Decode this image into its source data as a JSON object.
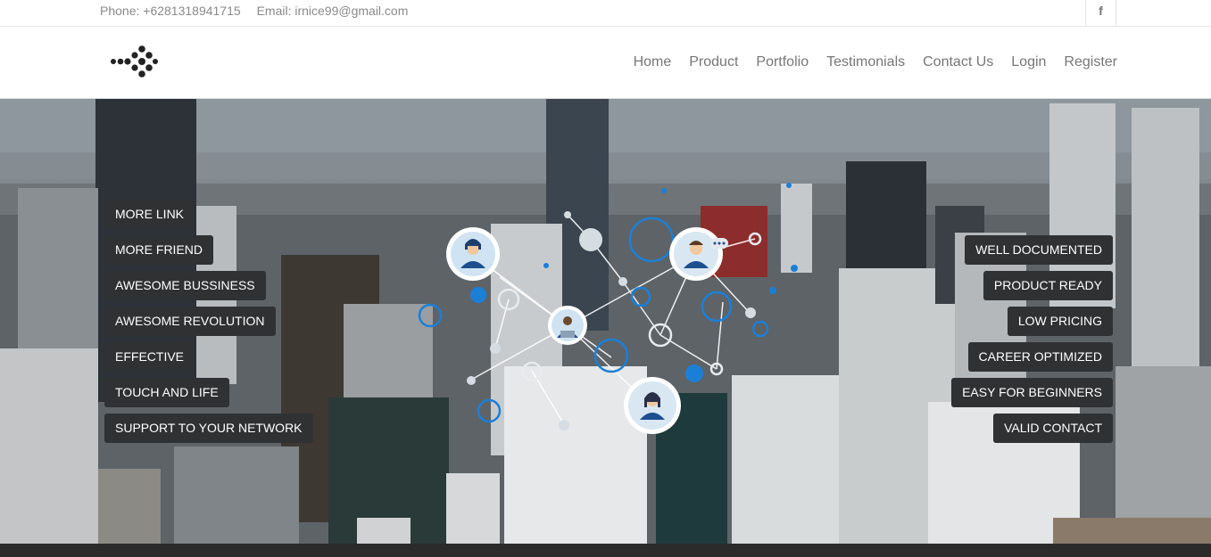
{
  "topbar": {
    "phone": "Phone: +6281318941715",
    "email": "Email: irnice99@gmail.com",
    "social_icon": "facebook-icon",
    "social_glyph": "f"
  },
  "nav": {
    "items": [
      "Home",
      "Product",
      "Portfolio",
      "Testimonials",
      "Contact Us",
      "Login",
      "Register"
    ]
  },
  "hero": {
    "left_tags": [
      "MORE LINK",
      "MORE FRIEND",
      "AWESOME BUSSINESS",
      "AWESOME REVOLUTION",
      "EFFECTIVE",
      "TOUCH AND LIFE",
      "SUPPORT TO YOUR NETWORK"
    ],
    "right_tags": [
      "WELL DOCUMENTED",
      "PRODUCT READY",
      "LOW PRICING",
      "CAREER OPTIMIZED",
      "EASY FOR BEGINNERS",
      "VALID CONTACT"
    ]
  },
  "colors": {
    "tag_bg": "#2f3133",
    "network_blue": "#1c7fd6",
    "nav_text": "#777777"
  }
}
